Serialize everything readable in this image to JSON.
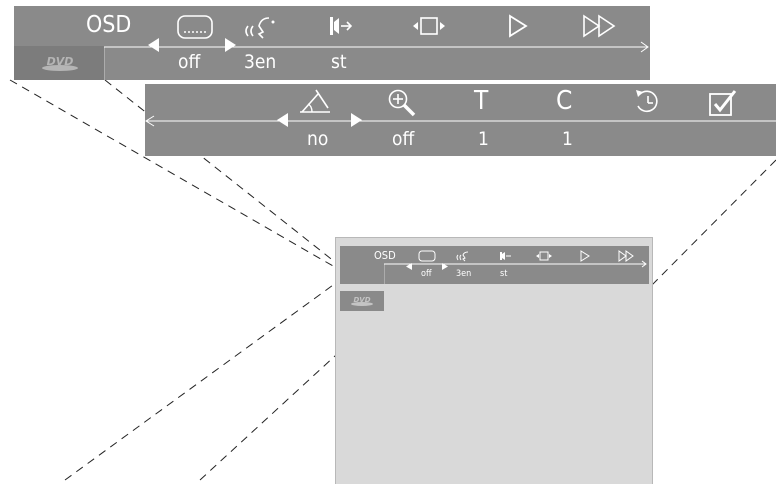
{
  "top_bar": {
    "osd_label": "OSD",
    "icons": [
      "subtitle-icon",
      "audio-language-icon",
      "audio-channel-icon",
      "angle-icon",
      "play-icon",
      "fast-forward-icon"
    ],
    "values": {
      "subtitle": "off",
      "audio_language": "3en",
      "audio_channel": "st"
    },
    "disc_logo": "DVD"
  },
  "second_bar": {
    "icons": [
      "angle-off-icon",
      "zoom-icon",
      "title-icon",
      "chapter-icon",
      "time-search-icon",
      "checkmark-icon"
    ],
    "title_glyph": "T",
    "chapter_glyph": "C",
    "values": {
      "angle": "no",
      "zoom": "off",
      "title": "1",
      "chapter": "1"
    }
  },
  "tv_preview": {
    "osd_label": "OSD",
    "values": {
      "subtitle": "off",
      "audio_language": "3en",
      "audio_channel": "st"
    },
    "disc_logo": "DVD"
  },
  "colors": {
    "bar": "#8a8a8a",
    "bar_dark": "#7a7a7a",
    "screen": "#d9d9d9",
    "text": "#ffffff"
  }
}
